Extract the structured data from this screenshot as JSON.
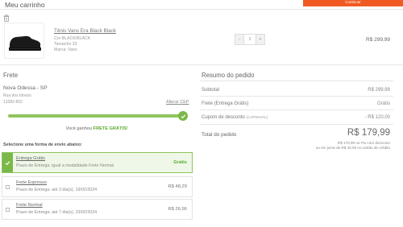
{
  "header": {
    "title": "Meu carrinho",
    "continue_label": "Continuar"
  },
  "icons": {
    "trash": "trash-icon",
    "check": "check-icon"
  },
  "colors": {
    "accent_orange": "#f05a22",
    "green": "#7bb84a",
    "green_text": "#5aab2c"
  },
  "product": {
    "name": "Tênis Vans Era Black Black",
    "color": "Cor BLACK/BLACK",
    "size": "Tamanho 33",
    "brand": "Marca: Vans",
    "quantity": "1",
    "minus": "-",
    "plus": "+",
    "price": "R$ 299,99"
  },
  "frete": {
    "title": "Frete",
    "city": "Nova Odessa - SP",
    "street": "Rua dos Idosos",
    "cep": "13382-652",
    "change_cep": "Alterar CEP",
    "progress_fraction": 1.0,
    "free_prefix": "Você ganhou ",
    "free_bold": "FRETE GRÁTIS!",
    "choose_label": "Selecione uma forma de envio abaixo:",
    "options": [
      {
        "name": "Entrega Grátis",
        "sub": "Prazo de Entrega: igual a modalidade Frete Normal",
        "price": "Grátis",
        "selected": true
      },
      {
        "name": "Frete Expresso",
        "sub": "Prazo de Entrega: até 3 dia(s), 19/02/2024",
        "price": "R$ 48,29",
        "selected": false
      },
      {
        "name": "Frete Normal",
        "sub": "Prazo de Entrega: até 7 dia(s), 23/02/2024",
        "price": "R$ 26,96",
        "selected": false
      }
    ]
  },
  "summary": {
    "title": "Resumo do pedido",
    "subtotal_label": "Subtotal",
    "subtotal_value": "R$ 299,99",
    "shipping_label": "Frete (Entrega Grátis)",
    "shipping_value": "Grátis",
    "coupon_label": "Cupom de desconto",
    "coupon_tag": "(CARNAVAL)",
    "coupon_value": "- R$ 120,00",
    "total_label": "Total do pedido",
    "total_value": "R$ 179,99",
    "note_pix": "R$ 170,99 no Pix com desconto",
    "note_card": "ou em juros de R$ 45,00 no cartão de crédito"
  }
}
